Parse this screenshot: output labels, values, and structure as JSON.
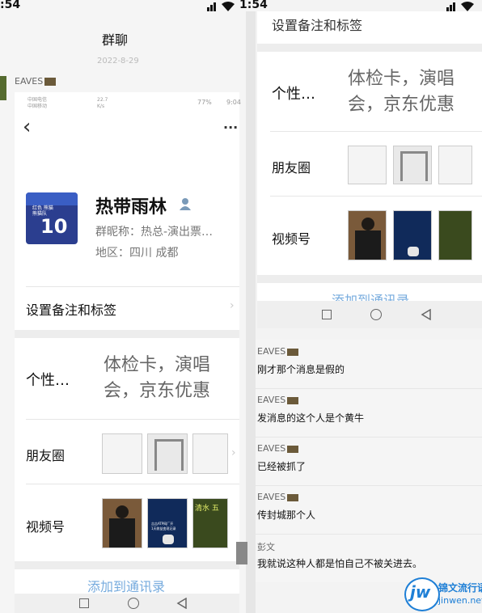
{
  "left_phone": {
    "status_time": ":54",
    "header_title": "群聊",
    "date_chip": "2022-8-29",
    "sender_name": "EAVES",
    "inner_status": {
      "carriers": [
        "中国电信",
        "中国移动"
      ],
      "speed_value": "22.7",
      "speed_unit": "K/s",
      "battery": "77%",
      "time": "9:04"
    },
    "back_glyph": "‹",
    "more_glyph": "···",
    "profile": {
      "avatar_jersey_number": "10",
      "avatar_jersey_text": "红色 熊猫\n熊猫队",
      "name": "热带雨林",
      "nickname": "群昵称：热总-演出票…",
      "region": "地区：四川  成都"
    },
    "remarks_label": "设置备注和标签",
    "signature_label": "个性…",
    "signature_text": "体检卡，演唱会，京东优惠",
    "moments_label": "朋友圈",
    "channels_label": "视频号",
    "bottom_cut": "添加到通讯录",
    "thumb_texts": [
      "吉吉ATP网厂开",
      "1天收益变现记录",
      "清水  五"
    ]
  },
  "right_phone": {
    "status_time": "1:54",
    "top_cut": "设置备注和标签",
    "signature_label": "个性…",
    "signature_text": "体检卡，演唱会，京东优惠",
    "moments_label": "朋友圈",
    "channels_label": "视频号",
    "bottom_cut": "添加到通讯录",
    "messages": [
      {
        "sender": "EAVES",
        "text": "刚才那个消息是假的"
      },
      {
        "sender": "EAVES",
        "text": "发消息的这个人是个黄牛"
      },
      {
        "sender": "EAVES",
        "text": "已经被抓了"
      },
      {
        "sender": "EAVES",
        "text": "传封城那个人"
      },
      {
        "sender": "彭文",
        "text": "我就说这种人都是怕自己不被关进去。"
      }
    ]
  },
  "watermark": {
    "logo_letters": "jw",
    "name": "锦文流行语",
    "url": "jinwen.net"
  },
  "colors": {
    "accent_blue": "#1a73c8",
    "watermark_blue": "#1e7fd6"
  }
}
